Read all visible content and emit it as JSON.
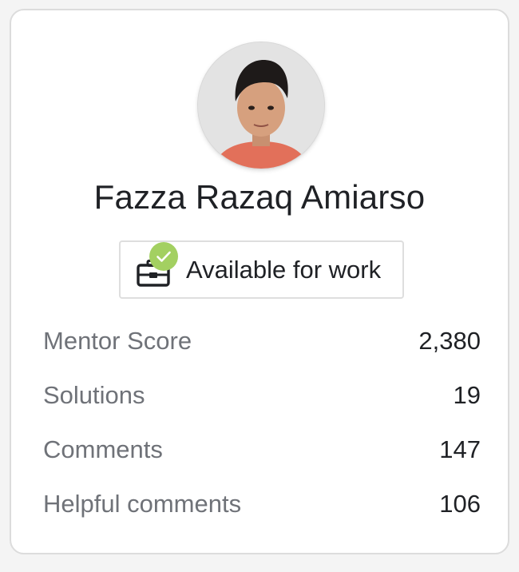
{
  "profile": {
    "name": "Fazza Razaq Amiarso",
    "avatar_icon": "profile-photo",
    "status_label": "Available for work",
    "status_icon": "briefcase-icon",
    "status_badge_icon": "check-icon",
    "badge_color": "#a3d061"
  },
  "stats": [
    {
      "label": "Mentor Score",
      "value": "2,380"
    },
    {
      "label": "Solutions",
      "value": "19"
    },
    {
      "label": "Comments",
      "value": "147"
    },
    {
      "label": "Helpful comments",
      "value": "106"
    }
  ]
}
